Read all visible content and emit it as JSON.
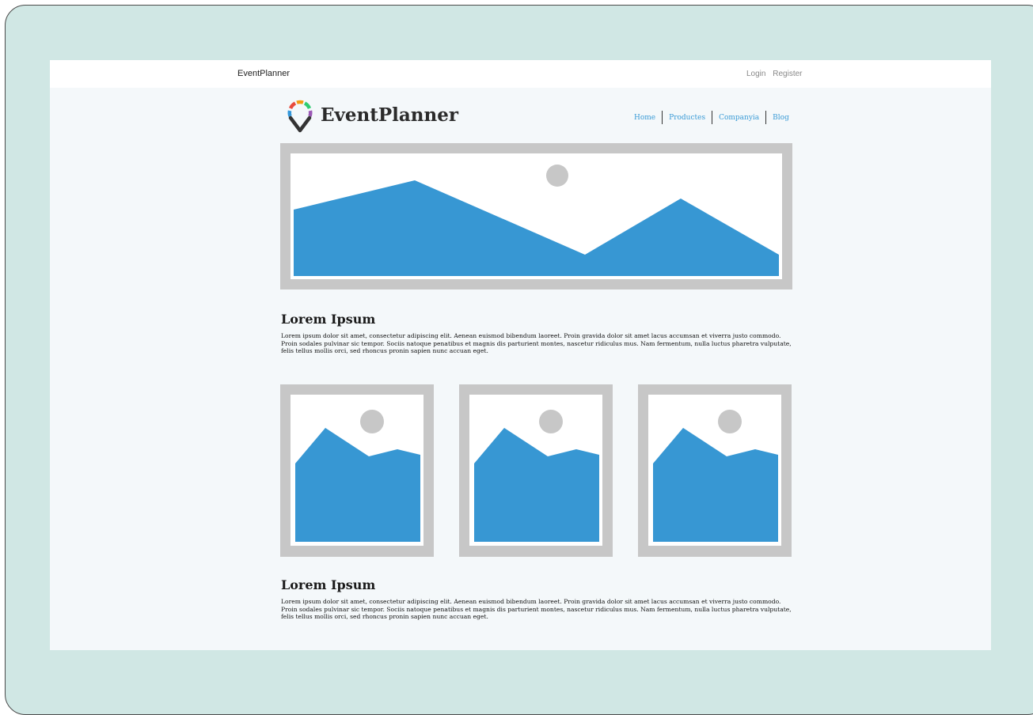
{
  "topbar": {
    "brand": "EventPlanner",
    "login_label": "Login",
    "register_label": "Register"
  },
  "header": {
    "logo_text": "EventPlanner",
    "logo_icon": "map-pin-icon",
    "nav": [
      {
        "label": "Home"
      },
      {
        "label": "Productes"
      },
      {
        "label": "Companyia"
      },
      {
        "label": "Blog"
      }
    ]
  },
  "sections": [
    {
      "title": "Lorem Ipsum",
      "body": "Lorem ipsum dolor sit amet, consectetur adipiscing elit. Aenean euismod bibendum laoreet. Proin gravida dolor sit amet lacus accumsan et viverra justo commodo. Proin sodales pulvinar sic tempor. Sociis natoque penatibus et magnis dis parturient montes, nascetur ridiculus mus. Nam fermentum, nulla luctus pharetra vulputate, felis tellus mollis orci, sed rhoncus pronin sapien nunc accuan eget."
    },
    {
      "title": "Lorem Ipsum",
      "body": "Lorem ipsum dolor sit amet, consectetur adipiscing elit. Aenean euismod bibendum laoreet. Proin gravida dolor sit amet lacus accumsan et viverra justo commodo. Proin sodales pulvinar sic tempor. Sociis natoque penatibus et magnis dis parturient montes, nascetur ridiculus mus. Nam fermentum, nulla luctus pharetra vulputate, felis tellus mollis orci, sed rhoncus pronin sapien nunc accuan eget."
    }
  ],
  "images": {
    "hero_icon": "image-placeholder-icon",
    "thumb_icon": "image-placeholder-icon"
  },
  "colors": {
    "frame_bg": "#d0e7e4",
    "page_bg": "#f4f8fa",
    "accent": "#3a9bd6",
    "placeholder_frame": "#c7c7c7",
    "placeholder_fill": "#3797d3"
  }
}
